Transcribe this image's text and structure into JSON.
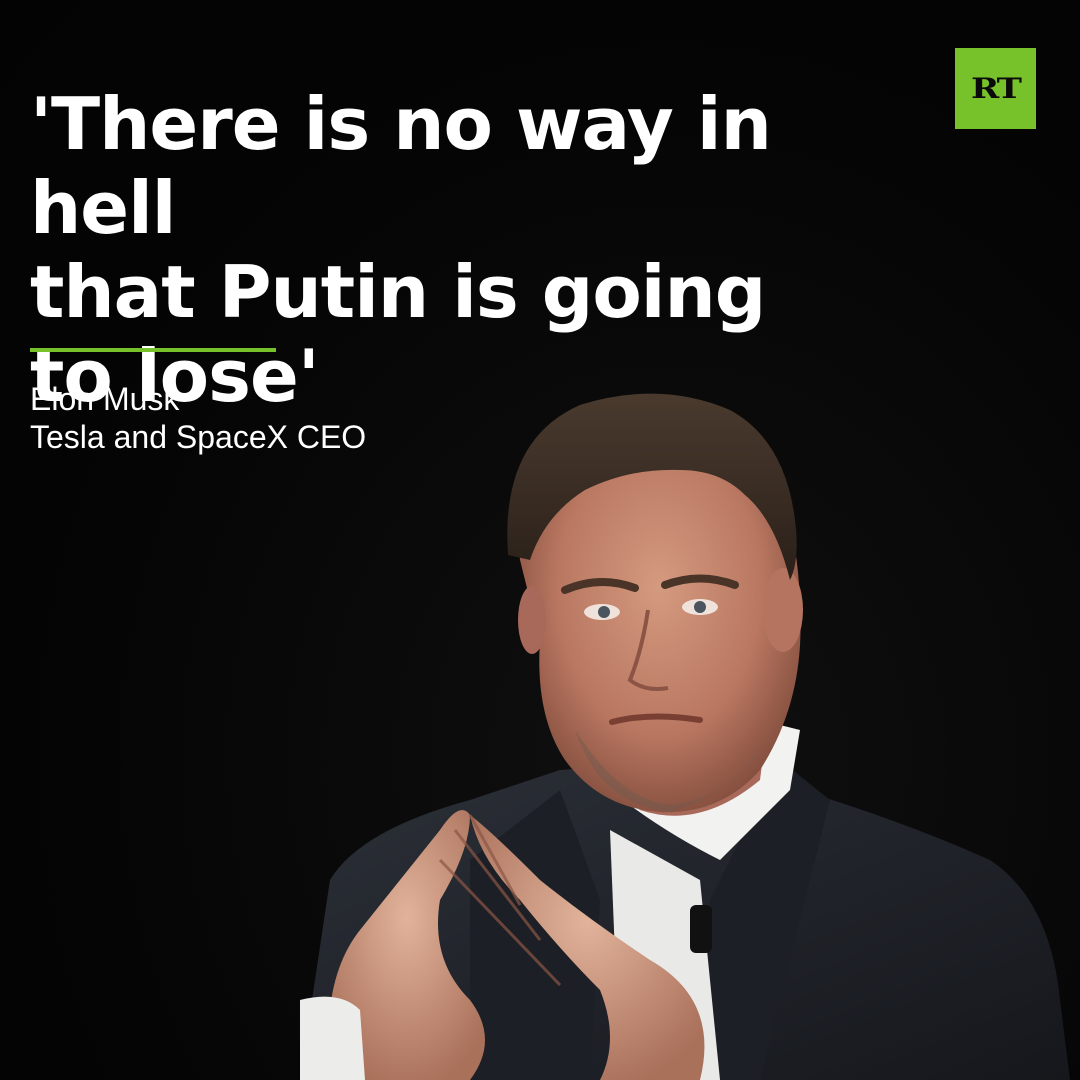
{
  "quote": {
    "text": "'There is no way in hell\nthat Putin is going\nto lose'"
  },
  "attribution": {
    "name": "Elon Musk",
    "title": "Tesla and SpaceX CEO"
  },
  "logo": {
    "text": "RT",
    "color": "#77c12a"
  },
  "colors": {
    "background": "#060606",
    "accent": "#77c12a",
    "text": "#ffffff"
  }
}
